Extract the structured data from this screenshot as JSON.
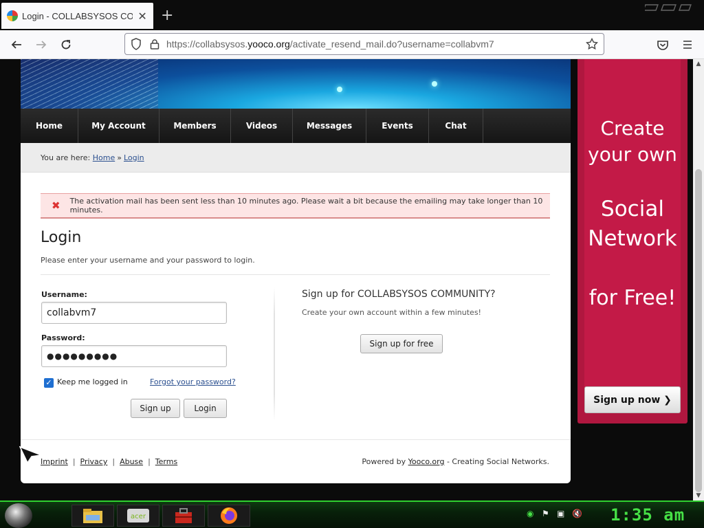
{
  "browser": {
    "tab_title": "Login - COLLABSYSOS COMMU",
    "tab_close": "✕",
    "new_tab": "+",
    "url_prefix": "https://collabsysos.",
    "url_host": "yooco.org",
    "url_path": "/activate_resend_mail.do?username=collabvm7"
  },
  "site": {
    "nav": [
      "Home",
      "My Account",
      "Members",
      "Videos",
      "Messages",
      "Events",
      "Chat"
    ],
    "breadcrumb": {
      "prefix": "You are here:",
      "home": "Home",
      "separator": "»",
      "current": "Login"
    },
    "alert": {
      "icon": "✖",
      "message": "The activation mail has been sent less than 10 minutes ago. Please wait a bit because the emailing may take longer than 10 minutes."
    },
    "login": {
      "title": "Login",
      "subtitle": "Please enter your username and your password to login.",
      "username_label": "Username:",
      "username_value": "collabvm7",
      "password_label": "Password:",
      "password_value": "●●●●●●●●●",
      "keep_logged_in": "Keep me logged in",
      "keep_logged_in_checked": true,
      "forgot": "Forgot your password?",
      "signup_button": "Sign up",
      "login_button": "Login"
    },
    "signup_panel": {
      "title": "Sign up for COLLABSYSOS COMMUNITY?",
      "subtitle": "Create your own account within a few minutes!",
      "button": "Sign up for free"
    },
    "footer": {
      "links": [
        "Imprint",
        "Privacy",
        "Abuse",
        "Terms"
      ],
      "powered_prefix": "Powered by",
      "powered_link": "Yooco.org",
      "powered_suffix": "- Creating Social Networks."
    }
  },
  "ad": {
    "line1": "Create",
    "line2": "your own",
    "line3": "Social",
    "line4": "Network",
    "line5": "for Free!",
    "button": "Sign up now",
    "button_icon": "❯"
  },
  "taskbar": {
    "clock": "1:35 am"
  },
  "colors": {
    "ad_bg": "#c31a47",
    "nav_bg": "#1f1f1f",
    "alert_bg": "#fde5e5",
    "taskbar_accent": "#2fd12f"
  }
}
